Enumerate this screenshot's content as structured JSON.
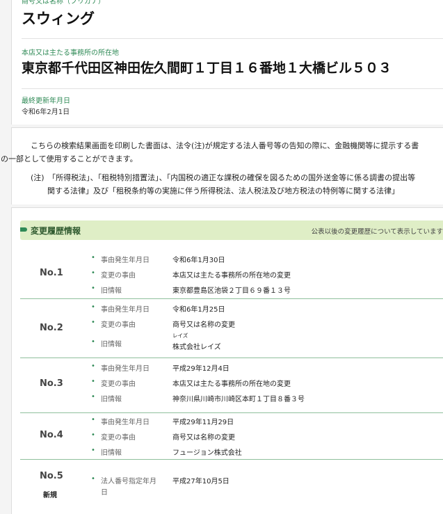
{
  "company": {
    "name_label": "商号又は名称（フリガナ）",
    "name": "スウィング",
    "address_label": "本店又は主たる事務所の所在地",
    "address": "東京都千代田区神田佐久間町１丁目１６番地１大橋ビル５０３",
    "updated_label": "最終更新年月日",
    "updated_date": "令和6年2月1日"
  },
  "notice": {
    "line1": "こちらの検索結果画面を印刷した書面は、法令(注)が規定する法人番号等の告知の際に、金融機関等に提示する書",
    "line2": "の一部として使用することができます。",
    "note_line1": "(注)　「所得税法」、「租税特別措置法」、「内国税の適正な課税の確保を図るための国外送金等に係る調書の提出等",
    "note_line2": "関する法律」及び「租税条約等の実施に伴う所得税法、法人税法及び地方税法の特例等に関する法律」"
  },
  "history": {
    "title": "変更履歴情報",
    "note": "公表以後の変更履歴について表示しています",
    "entries": [
      {
        "no": "No.1",
        "rows": [
          {
            "label": "事由発生年月日",
            "value": "令和6年1月30日"
          },
          {
            "label": "変更の事由",
            "value": "本店又は主たる事務所の所在地の変更"
          },
          {
            "label": "旧情報",
            "value": "東京都豊島区池袋２丁目６９番１３号"
          }
        ]
      },
      {
        "no": "No.2",
        "rows": [
          {
            "label": "事由発生年月日",
            "value": "令和6年1月25日"
          },
          {
            "label": "変更の事由",
            "value": "商号又は名称の変更"
          },
          {
            "label": "旧情報",
            "value": "株式会社レイズ",
            "ruby": "レイズ"
          }
        ]
      },
      {
        "no": "No.3",
        "rows": [
          {
            "label": "事由発生年月日",
            "value": "平成29年12月4日"
          },
          {
            "label": "変更の事由",
            "value": "本店又は主たる事務所の所在地の変更"
          },
          {
            "label": "旧情報",
            "value": "神奈川県川崎市川崎区本町１丁目８番３号"
          }
        ]
      },
      {
        "no": "No.4",
        "rows": [
          {
            "label": "事由発生年月日",
            "value": "平成29年11月29日"
          },
          {
            "label": "変更の事由",
            "value": "商号又は名称の変更"
          },
          {
            "label": "旧情報",
            "value": "フュージョン株式会社"
          }
        ]
      },
      {
        "no": "No.5",
        "sub": "新規",
        "rows": [
          {
            "label": "法人番号指定年月",
            "label2": "日",
            "value": "平成27年10月5日"
          }
        ]
      }
    ]
  },
  "colors": {
    "accent": "#2f8a56",
    "header_bg": "#dfeec6",
    "divider": "#8fbf9c"
  }
}
